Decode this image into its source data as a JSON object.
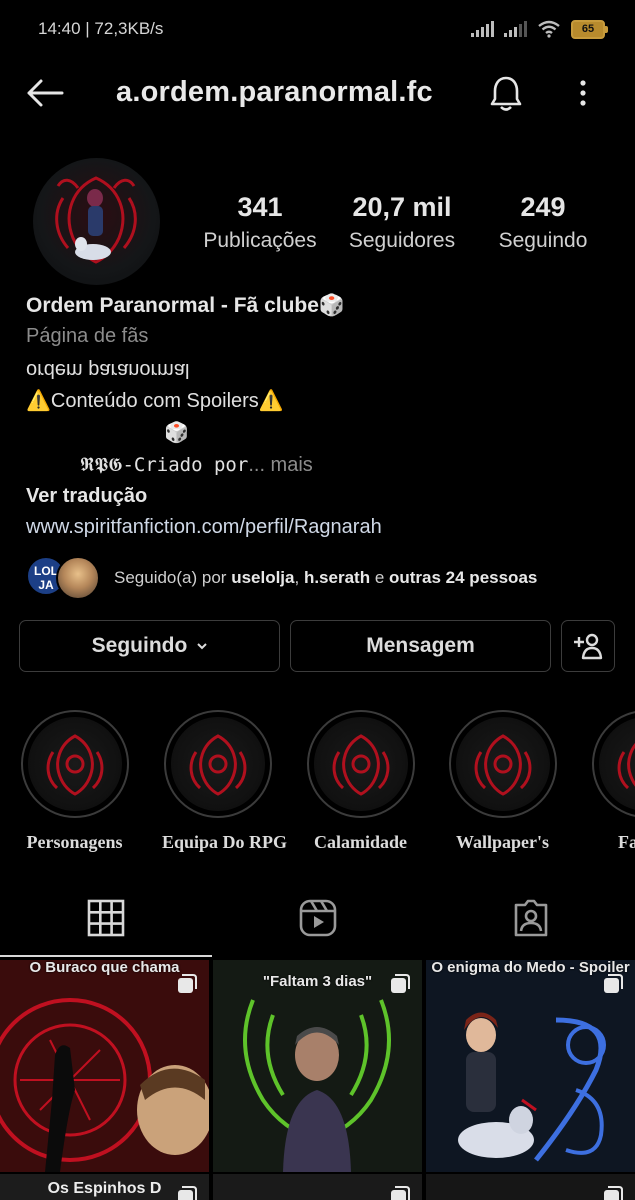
{
  "status_bar": {
    "time": "14:40 | 72,3KB/s",
    "battery": "65"
  },
  "header": {
    "username": "a.ordem.paranormal.fc"
  },
  "profile": {
    "stats": [
      {
        "value": "341",
        "label": "Publicações"
      },
      {
        "value": "20,7 mil",
        "label": "Seguidores"
      },
      {
        "value": "249",
        "label": "Seguindo"
      }
    ],
    "name": "Ordem Paranormal - Fã clube🎲",
    "category": "Página de fãs",
    "bio_mirrored": "ordem paranormal",
    "bio_spoilers": "⚠️Conteúdo com Spoilers⚠️",
    "bio_dice": "🎲",
    "bio_rpg": "𝕽𝕻𝕲-Criado por",
    "bio_more": "... mais",
    "translate": "Ver tradução",
    "link": "www.spiritfanfiction.com/perfil/Ragnarah"
  },
  "followed_by": {
    "avatar1_text": "LOL\nJA",
    "prefix": "Seguido(a) por ",
    "user1": "uselolja",
    "sep": ", ",
    "user2": "h.serath",
    "mid": " e ",
    "others": "outras 24 pessoas"
  },
  "actions": {
    "following": "Seguindo",
    "message": "Mensagem"
  },
  "highlights": [
    {
      "label": "Personagens"
    },
    {
      "label": "Equipa Do RPG"
    },
    {
      "label": "Calamidade"
    },
    {
      "label": "Wallpaper's"
    },
    {
      "label": "Fa"
    }
  ],
  "posts": [
    {
      "caption": "O Buraco que chama"
    },
    {
      "caption": "\"Faltam 3 dias\""
    },
    {
      "caption": "O enigma do Medo - Spoiler"
    },
    {
      "caption": "Os Espinhos D"
    }
  ],
  "colors": {
    "background": "#000000",
    "accent_red": "#c01020",
    "text": "#e6e6e6",
    "muted": "#8c8c8c"
  }
}
